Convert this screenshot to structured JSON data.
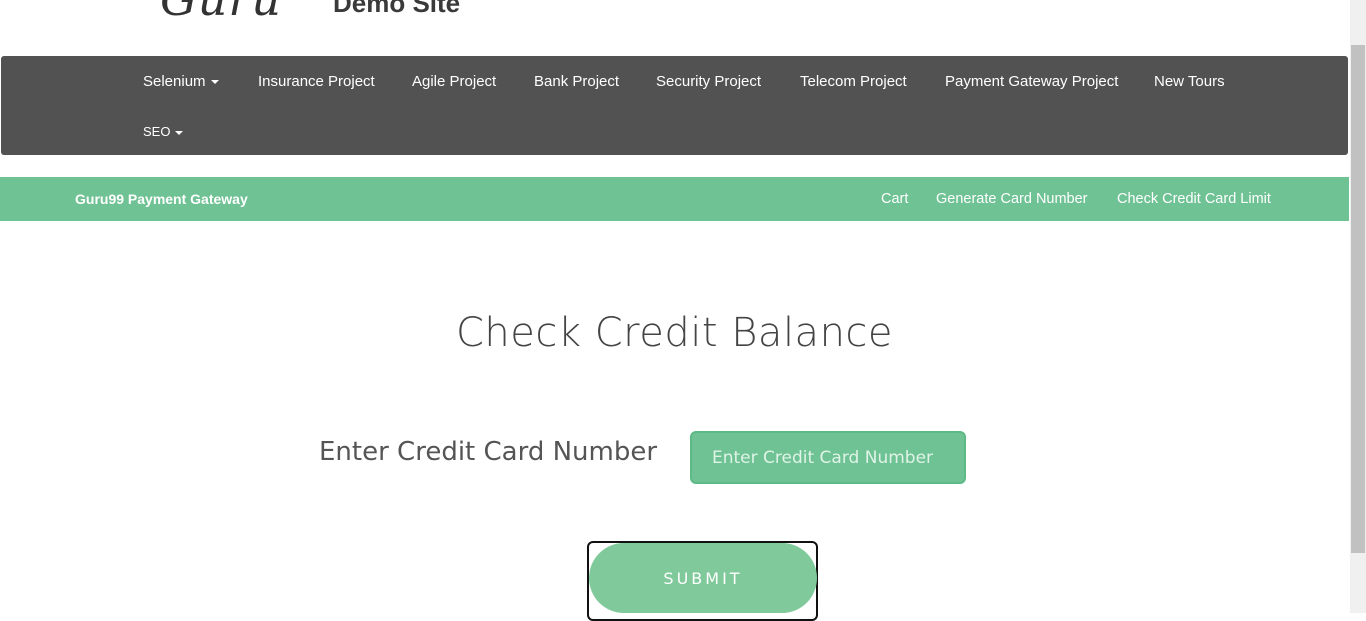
{
  "header": {
    "logo_text": "Guru",
    "site_title": "Demo Site"
  },
  "main_nav": {
    "items": [
      {
        "label": "Selenium",
        "has_dropdown": true
      },
      {
        "label": "Insurance Project"
      },
      {
        "label": "Agile Project"
      },
      {
        "label": "Bank Project"
      },
      {
        "label": "Security Project"
      },
      {
        "label": "Telecom Project"
      },
      {
        "label": "Payment Gateway Project"
      },
      {
        "label": "New Tours"
      },
      {
        "label": "SEO",
        "has_dropdown": true
      }
    ]
  },
  "sub_nav": {
    "brand": "Guru99 Payment Gateway",
    "links": [
      "Cart",
      "Generate Card Number",
      "Check Credit Card Limit"
    ]
  },
  "content": {
    "title": "Check Credit Balance",
    "field_label": "Enter Credit Card Number",
    "input_placeholder": "Enter Credit Card Number",
    "input_value": "",
    "submit_label": "SUBMIT"
  },
  "colors": {
    "nav_bg": "#525252",
    "accent_green": "#6fc294",
    "button_green": "#7fc99b"
  },
  "icons": [
    "caret-down-icon"
  ]
}
